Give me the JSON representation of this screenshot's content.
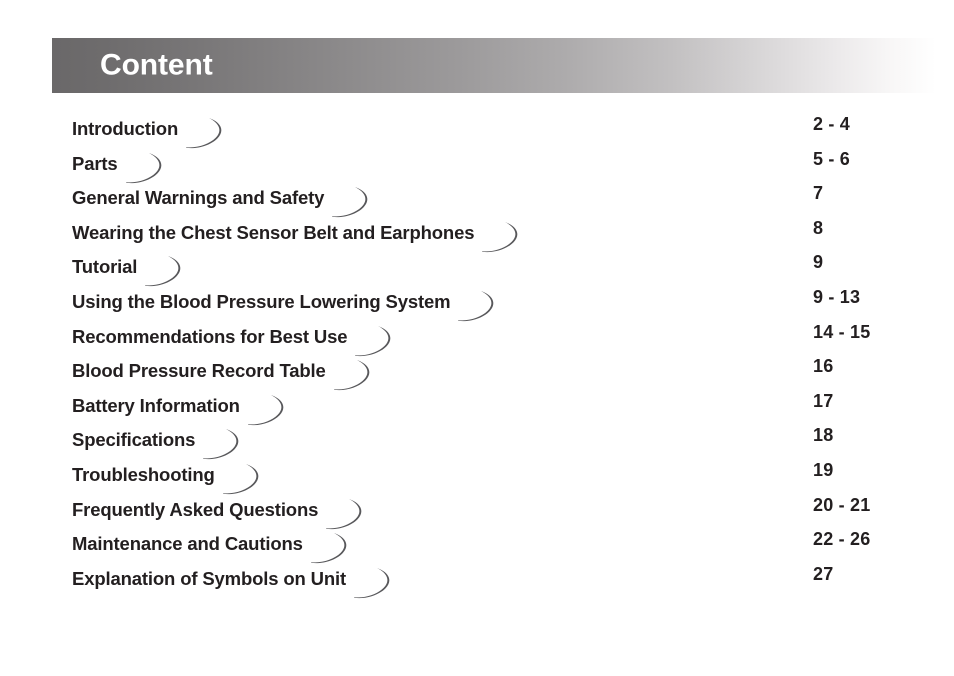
{
  "header": {
    "title": "Content",
    "gradient_start": "#6a6869",
    "gradient_end": "#ffffff",
    "title_color": "#ffffff"
  },
  "text_color": "#231f20",
  "ornament": {
    "icon": "swoosh-flourish-icon"
  },
  "toc": {
    "entries": [
      {
        "label": "Introduction",
        "page": "2 - 4"
      },
      {
        "label": "Parts",
        "page": "5 - 6"
      },
      {
        "label": "General Warnings and Safety",
        "page": "7"
      },
      {
        "label": "Wearing the Chest Sensor Belt and Earphones",
        "page": "8"
      },
      {
        "label": "Tutorial",
        "page": "9"
      },
      {
        "label": "Using the Blood Pressure Lowering System",
        "page": "9 - 13"
      },
      {
        "label": "Recommendations for Best Use",
        "page": "14 - 15"
      },
      {
        "label": "Blood Pressure Record Table",
        "page": "16"
      },
      {
        "label": "Battery Information",
        "page": "17"
      },
      {
        "label": "Specifications",
        "page": "18"
      },
      {
        "label": "Troubleshooting",
        "page": "19"
      },
      {
        "label": "Frequently Asked Questions",
        "page": "20 - 21"
      },
      {
        "label": "Maintenance and Cautions",
        "page": "22 - 26"
      },
      {
        "label": "Explanation of Symbols on Unit",
        "page": "27"
      }
    ]
  }
}
